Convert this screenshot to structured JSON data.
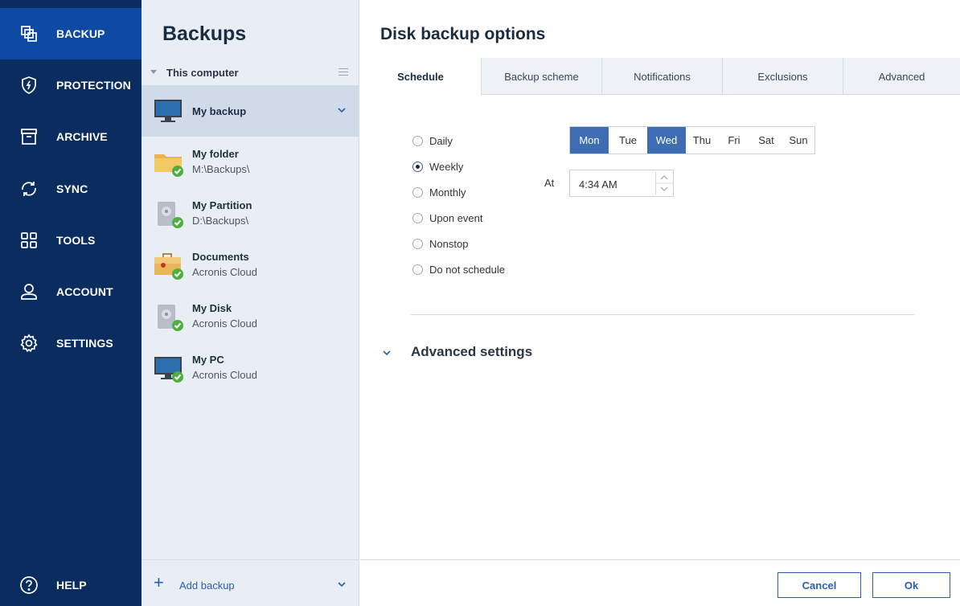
{
  "nav": {
    "items": [
      {
        "label": "BACKUP",
        "icon": "backup-icon"
      },
      {
        "label": "PROTECTION",
        "icon": "shield-icon"
      },
      {
        "label": "ARCHIVE",
        "icon": "archive-box-icon"
      },
      {
        "label": "SYNC",
        "icon": "sync-icon"
      },
      {
        "label": "TOOLS",
        "icon": "tools-grid-icon"
      },
      {
        "label": "ACCOUNT",
        "icon": "account-icon"
      },
      {
        "label": "SETTINGS",
        "icon": "gear-icon"
      }
    ],
    "help_label": "HELP",
    "active_item": "BACKUP",
    "colors": {
      "background": "#0a2c5f",
      "active": "#0e4aa3"
    }
  },
  "backups": {
    "title": "Backups",
    "group_label": "This computer",
    "items": [
      {
        "name": "My backup",
        "sub": "",
        "icon": "monitor-icon",
        "selected": true
      },
      {
        "name": "My folder",
        "sub": "M:\\Backups\\",
        "icon": "folder-icon"
      },
      {
        "name": "My Partition",
        "sub": "D:\\Backups\\",
        "icon": "hard-drive-icon"
      },
      {
        "name": "Documents",
        "sub": "Acronis Cloud",
        "icon": "briefcase-icon"
      },
      {
        "name": "My Disk",
        "sub": "Acronis Cloud",
        "icon": "hard-drive-icon"
      },
      {
        "name": "My PC",
        "sub": "Acronis Cloud",
        "icon": "monitor-icon"
      }
    ],
    "add_label": "Add backup"
  },
  "main": {
    "title": "Disk backup options",
    "tabs": [
      "Schedule",
      "Backup scheme",
      "Notifications",
      "Exclusions",
      "Advanced"
    ],
    "active_tab": "Schedule",
    "schedule": {
      "options": [
        "Daily",
        "Weekly",
        "Monthly",
        "Upon event",
        "Nonstop",
        "Do not schedule"
      ],
      "selected": "Weekly",
      "days": [
        "Mon",
        "Tue",
        "Wed",
        "Thu",
        "Fri",
        "Sat",
        "Sun"
      ],
      "selected_days": [
        "Mon",
        "Wed"
      ],
      "at_label": "At",
      "time": "4:34 AM"
    },
    "advanced_settings_label": "Advanced settings",
    "cancel_label": "Cancel",
    "ok_label": "Ok",
    "colors": {
      "accent": "#2b5db0",
      "day_selected": "#3f6db3"
    }
  }
}
